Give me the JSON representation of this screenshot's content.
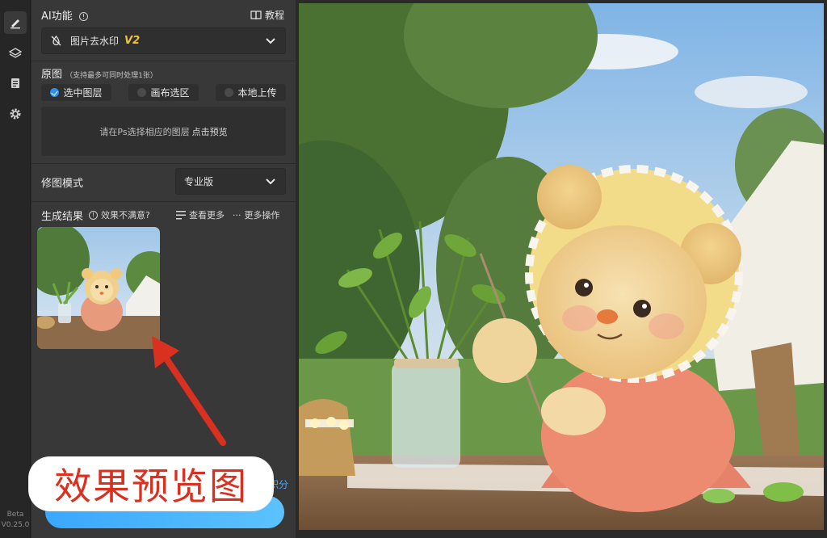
{
  "rail": {
    "icons": [
      "edit-icon",
      "layers-icon",
      "document-icon",
      "gear-icon"
    ],
    "beta": "Beta",
    "version": "V0.25.0"
  },
  "ai": {
    "title": "AI功能",
    "tutorial": "教程",
    "feature": "图片去水印",
    "feature_tag": "V2"
  },
  "source": {
    "title": "原图",
    "note": "（支持最多可同时处理1张）",
    "options": [
      "选中图层",
      "画布选区",
      "本地上传"
    ],
    "selected": "选中图层",
    "hint": "请在Ps选择相应的图层",
    "hint_link": "点击预览"
  },
  "mode": {
    "label": "修图模式",
    "value": "专业版"
  },
  "result": {
    "title": "生成结果",
    "unsatisfied": "效果不满意?",
    "view_more": "查看更多",
    "more_actions": "更多操作"
  },
  "overlay": {
    "text": "效果预览图",
    "points_fragment": "积分"
  },
  "colors": {
    "accent": "#2f8ff0",
    "annotation": "#d9301f"
  }
}
